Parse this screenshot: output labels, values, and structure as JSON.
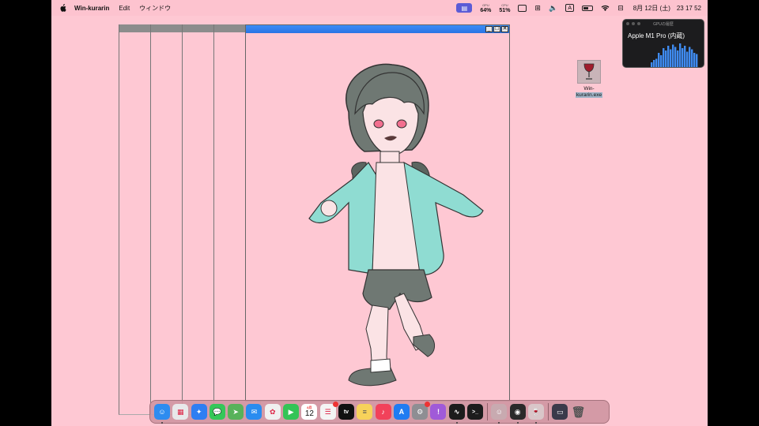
{
  "menubar": {
    "app_name": "Win-kurarin",
    "menus": [
      "Edit",
      "ウィンドウ"
    ],
    "status": {
      "gpu_label": "GPU",
      "gpu_value": "64%",
      "cpu_label": "CPU",
      "cpu_value": "51%",
      "input_source": "A",
      "date": "8月 12日 (土)",
      "time": "23 17 52"
    }
  },
  "gpu_widget": {
    "title": "GPUの履歴",
    "device": "Apple M1 Pro (内蔵)",
    "history": [
      0.2,
      0.3,
      0.35,
      0.6,
      0.5,
      0.8,
      0.7,
      0.9,
      0.75,
      0.95,
      0.85,
      0.7,
      1.0,
      0.8,
      0.9,
      0.65,
      0.85,
      0.75,
      0.6,
      0.55
    ]
  },
  "desktop_icon": {
    "label_line1": "Win-",
    "label_line2": "kurarin.exe"
  },
  "window": {
    "minimize": "_",
    "maximize": "□",
    "close": "✕"
  },
  "dock": {
    "calendar_day": "12",
    "calendar_month": "8月",
    "items": [
      {
        "name": "finder-icon",
        "color": "#2d8cf0",
        "glyph": "☺"
      },
      {
        "name": "launchpad-icon",
        "color": "#e8e8ea",
        "glyph": "▦"
      },
      {
        "name": "safari-icon",
        "color": "#2e7ef2",
        "glyph": "✦"
      },
      {
        "name": "messages-icon",
        "color": "#35c759",
        "glyph": "💬"
      },
      {
        "name": "maps-icon",
        "color": "#58b25a",
        "glyph": "➤"
      },
      {
        "name": "mail-icon",
        "color": "#2a8cf0",
        "glyph": "✉"
      },
      {
        "name": "photos-icon",
        "color": "#f0f0f0",
        "glyph": "✿"
      },
      {
        "name": "facetime-icon",
        "color": "#33c456",
        "glyph": "▶"
      },
      {
        "name": "calendar-icon",
        "color": "#ffffff",
        "glyph": ""
      },
      {
        "name": "reminders-icon",
        "color": "#f4f4f4",
        "glyph": "☰"
      },
      {
        "name": "tv-icon",
        "color": "#111111",
        "glyph": "tv"
      },
      {
        "name": "notes-icon",
        "color": "#f7d25a",
        "glyph": "≡"
      },
      {
        "name": "music-icon",
        "color": "#f2425a",
        "glyph": "♪"
      },
      {
        "name": "app-store-icon",
        "color": "#1f7cf2",
        "glyph": "A"
      },
      {
        "name": "system-settings-icon",
        "color": "#8e8e93",
        "glyph": "⚙"
      },
      {
        "name": "feedback-icon",
        "color": "#a05ad8",
        "glyph": "!"
      },
      {
        "name": "activity-monitor-icon",
        "color": "#1c1c1c",
        "glyph": "∿"
      },
      {
        "name": "terminal-icon",
        "color": "#1c1c1c",
        "glyph": ">_"
      },
      {
        "name": "win-kurarin-app-icon",
        "color": "#c8aab0",
        "glyph": "☺"
      },
      {
        "name": "obs-icon",
        "color": "#2a2a2a",
        "glyph": "◉"
      },
      {
        "name": "wine-icon",
        "color": "#d9c6c9",
        "glyph": "🍷"
      },
      {
        "name": "screenshot-icon",
        "color": "#3a3a4a",
        "glyph": "▭"
      },
      {
        "name": "trash-icon",
        "color": "transparent",
        "glyph": "🗑"
      }
    ]
  }
}
